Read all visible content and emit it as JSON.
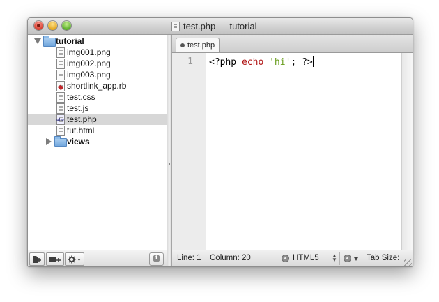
{
  "window": {
    "title": "test.php — tutorial"
  },
  "sidebar": {
    "root": {
      "label": "tutorial"
    },
    "items": [
      {
        "label": "img001.png",
        "type": "file"
      },
      {
        "label": "img002.png",
        "type": "file"
      },
      {
        "label": "img003.png",
        "type": "file"
      },
      {
        "label": "shortlink_app.rb",
        "type": "ruby-file"
      },
      {
        "label": "test.css",
        "type": "file"
      },
      {
        "label": "test.js",
        "type": "file"
      },
      {
        "label": "test.php",
        "type": "php-file",
        "selected": true
      },
      {
        "label": "tut.html",
        "type": "file"
      }
    ],
    "subfolder": {
      "label": "views"
    },
    "bottom": {
      "new_file_icon": "new-file-icon",
      "new_folder_icon": "new-folder-icon",
      "gear_icon": "gear-icon",
      "info_icon": "info-icon",
      "info_label": "i"
    }
  },
  "editor": {
    "tab_label": "test.php",
    "line_number": "1",
    "code": {
      "open": "<?php ",
      "keyword": "echo",
      "space": " ",
      "string": "'hi'",
      "rest": "; ?>"
    }
  },
  "statusbar": {
    "line": "Line: 1",
    "column": "Column: 20",
    "language": "HTML5",
    "tab_size": "Tab Size:"
  },
  "colors": {
    "keyword": "#b01515",
    "string": "#6a9e1f",
    "selection": "#d7d7d7"
  }
}
